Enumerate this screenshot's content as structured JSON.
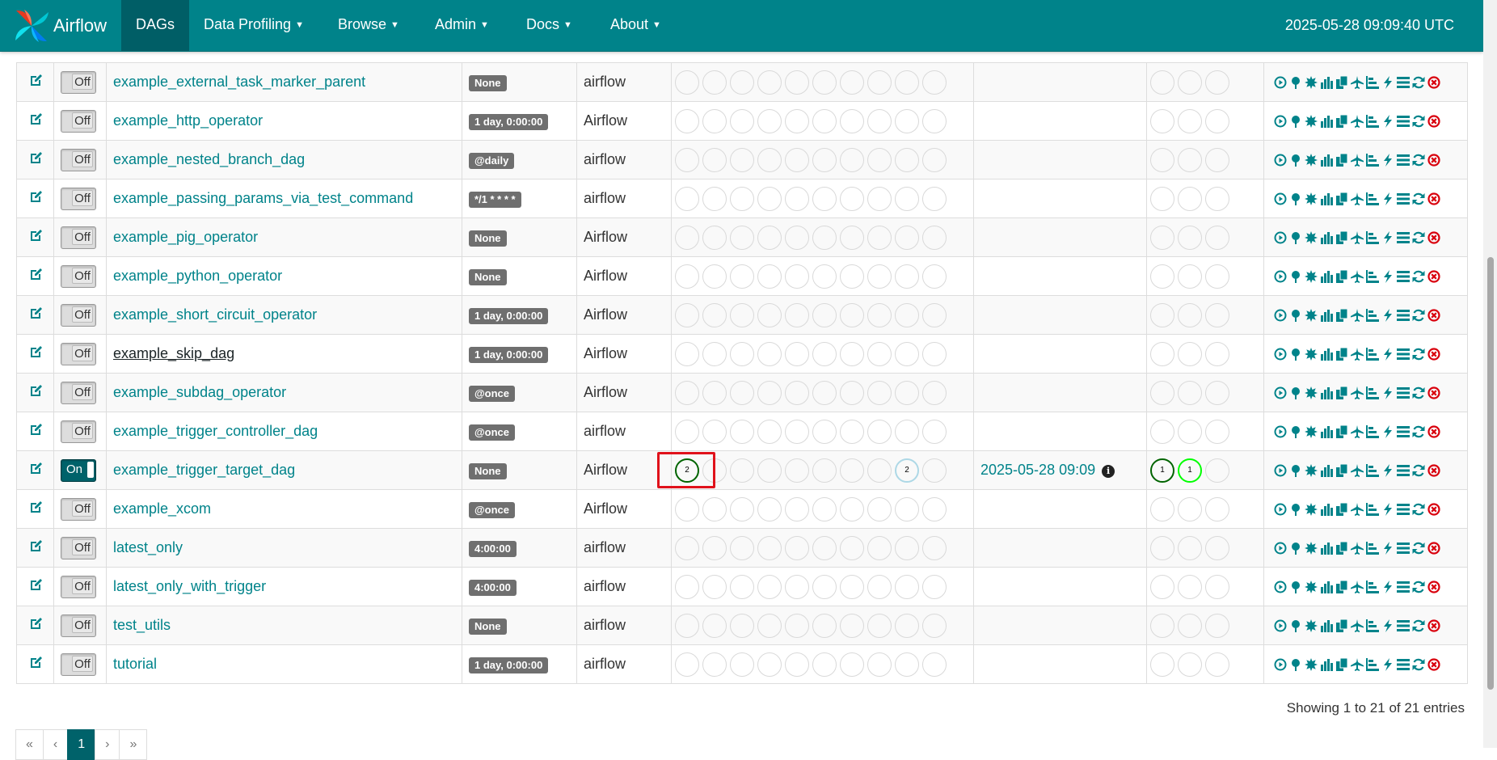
{
  "nav": {
    "brand": "Airflow",
    "items": [
      {
        "label": "DAGs",
        "caret": false
      },
      {
        "label": "Data Profiling",
        "caret": true
      },
      {
        "label": "Browse",
        "caret": true
      },
      {
        "label": "Admin",
        "caret": true
      },
      {
        "label": "Docs",
        "caret": true
      },
      {
        "label": "About",
        "caret": true
      }
    ],
    "clock": "2025-05-28 09:09:40 UTC"
  },
  "rows": [
    {
      "toggle": "Off",
      "name": "example_external_task_marker_parent",
      "schedule": "None",
      "owner": "airflow",
      "last_run": "",
      "dag_runs": [],
      "recent_tasks": []
    },
    {
      "toggle": "Off",
      "name": "example_http_operator",
      "schedule": "1 day, 0:00:00",
      "owner": "Airflow",
      "last_run": "",
      "dag_runs": [],
      "recent_tasks": []
    },
    {
      "toggle": "Off",
      "name": "example_nested_branch_dag",
      "schedule": "@daily",
      "owner": "airflow",
      "last_run": "",
      "dag_runs": [],
      "recent_tasks": []
    },
    {
      "toggle": "Off",
      "name": "example_passing_params_via_test_command",
      "schedule": "*/1 * * * *",
      "owner": "airflow",
      "last_run": "",
      "dag_runs": [],
      "recent_tasks": []
    },
    {
      "toggle": "Off",
      "name": "example_pig_operator",
      "schedule": "None",
      "owner": "Airflow",
      "last_run": "",
      "dag_runs": [],
      "recent_tasks": []
    },
    {
      "toggle": "Off",
      "name": "example_python_operator",
      "schedule": "None",
      "owner": "Airflow",
      "last_run": "",
      "dag_runs": [],
      "recent_tasks": []
    },
    {
      "toggle": "Off",
      "name": "example_short_circuit_operator",
      "schedule": "1 day, 0:00:00",
      "owner": "Airflow",
      "last_run": "",
      "dag_runs": [],
      "recent_tasks": []
    },
    {
      "toggle": "Off",
      "name": "example_skip_dag",
      "schedule": "1 day, 0:00:00",
      "owner": "Airflow",
      "last_run": "",
      "dag_runs": [],
      "recent_tasks": [],
      "hover": true
    },
    {
      "toggle": "Off",
      "name": "example_subdag_operator",
      "schedule": "@once",
      "owner": "Airflow",
      "last_run": "",
      "dag_runs": [],
      "recent_tasks": []
    },
    {
      "toggle": "Off",
      "name": "example_trigger_controller_dag",
      "schedule": "@once",
      "owner": "airflow",
      "last_run": "",
      "dag_runs": [],
      "recent_tasks": []
    },
    {
      "toggle": "On",
      "name": "example_trigger_target_dag",
      "schedule": "None",
      "owner": "Airflow",
      "last_run": "2025-05-28 09:09",
      "dag_runs": [
        {
          "index": 0,
          "count": "2",
          "state": "success"
        },
        {
          "index": 8,
          "count": "2",
          "state": "queued"
        }
      ],
      "recent_tasks": [
        {
          "index": 0,
          "count": "1",
          "state": "success"
        },
        {
          "index": 1,
          "count": "1",
          "state": "running"
        }
      ]
    },
    {
      "toggle": "Off",
      "name": "example_xcom",
      "schedule": "@once",
      "owner": "Airflow",
      "last_run": "",
      "dag_runs": [],
      "recent_tasks": []
    },
    {
      "toggle": "Off",
      "name": "latest_only",
      "schedule": "4:00:00",
      "owner": "airflow",
      "last_run": "",
      "dag_runs": [],
      "recent_tasks": []
    },
    {
      "toggle": "Off",
      "name": "latest_only_with_trigger",
      "schedule": "4:00:00",
      "owner": "airflow",
      "last_run": "",
      "dag_runs": [],
      "recent_tasks": []
    },
    {
      "toggle": "Off",
      "name": "test_utils",
      "schedule": "None",
      "owner": "airflow",
      "last_run": "",
      "dag_runs": [],
      "recent_tasks": []
    },
    {
      "toggle": "Off",
      "name": "tutorial",
      "schedule": "1 day, 0:00:00",
      "owner": "airflow",
      "last_run": "",
      "dag_runs": [],
      "recent_tasks": []
    }
  ],
  "link_icons": [
    "trigger-dag-icon",
    "tree-view-icon",
    "graph-view-icon",
    "duration-icon",
    "retries-icon",
    "landing-times-icon",
    "gantt-icon",
    "code-view-icon",
    "logs-icon",
    "refresh-icon",
    "delete-icon"
  ],
  "info_glyph": "i",
  "footer": {
    "showing": "Showing 1 to 21 of 21 entries",
    "pager": [
      "«",
      "‹",
      "1",
      "›",
      "»"
    ]
  },
  "colors": {
    "navbar": "#00838a",
    "link": "#00838a",
    "success": "#006400",
    "running": "#00ff00",
    "queued": "#add8e6",
    "delete": "#d9000d"
  }
}
